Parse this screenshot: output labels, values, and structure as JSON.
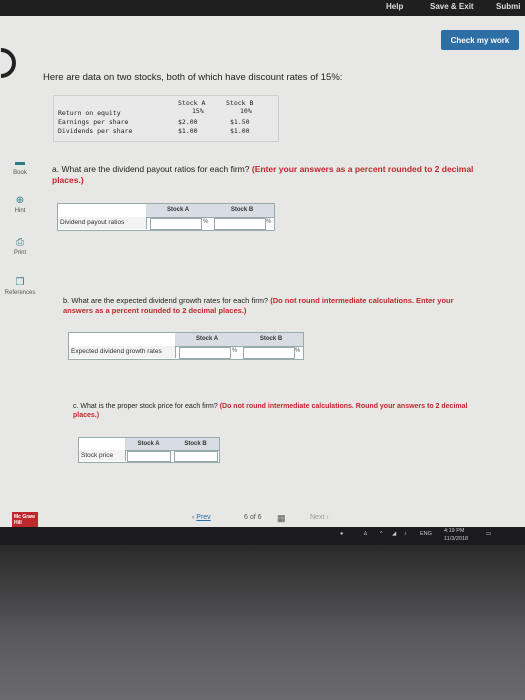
{
  "topbar": {
    "help": "Help",
    "save_exit": "Save & Exit",
    "submit": "Submi"
  },
  "check_button": "Check my work",
  "sidebar": {
    "items": [
      {
        "label": "Book",
        "icon": "book-icon"
      },
      {
        "label": "Hint",
        "icon": "hint-icon"
      },
      {
        "label": "Print",
        "icon": "print-icon"
      },
      {
        "label": "References",
        "icon": "references-icon"
      }
    ]
  },
  "intro": "Here are data on two stocks, both of which have discount rates of 15%:",
  "data_table": {
    "headers": [
      "Stock A",
      "Stock B"
    ],
    "rows": [
      {
        "label": "Return on equity",
        "a": "15%",
        "b": "10%"
      },
      {
        "label": "Earnings per share",
        "a": "$2.00",
        "b": "$1.50"
      },
      {
        "label": "Dividends per share",
        "a": "$1.00",
        "b": "$1.00"
      }
    ]
  },
  "question_a": {
    "text": "a. What are the dividend payout ratios for each firm?",
    "instruction": "(Enter your answers as a percent rounded to 2 decimal places.)",
    "headers": [
      "Stock A",
      "Stock B"
    ],
    "row_label": "Dividend payout ratios",
    "unit": "%"
  },
  "question_b": {
    "text": "b. What are the expected dividend growth rates for each firm?",
    "instruction": "(Do not round intermediate calculations. Enter your answers as a percent rounded to 2 decimal places.)",
    "headers": [
      "Stock A",
      "Stock B"
    ],
    "row_label": "Expected dividend growth rates",
    "unit": "%"
  },
  "question_c": {
    "text": "c. What is the proper stock price for each firm?",
    "instruction": "(Do not round intermediate calculations. Round your answers to 2 decimal places.)",
    "headers": [
      "Stock A",
      "Stock B"
    ],
    "row_label": "Stock price"
  },
  "pager": {
    "prev": "Prev",
    "current": "6",
    "of": "of",
    "total": "6",
    "next": "Next"
  },
  "logo": "Mc Graw Hill",
  "taskbar": {
    "lang": "ENG",
    "time": "4:19 PM",
    "date": "11/3/2018"
  }
}
